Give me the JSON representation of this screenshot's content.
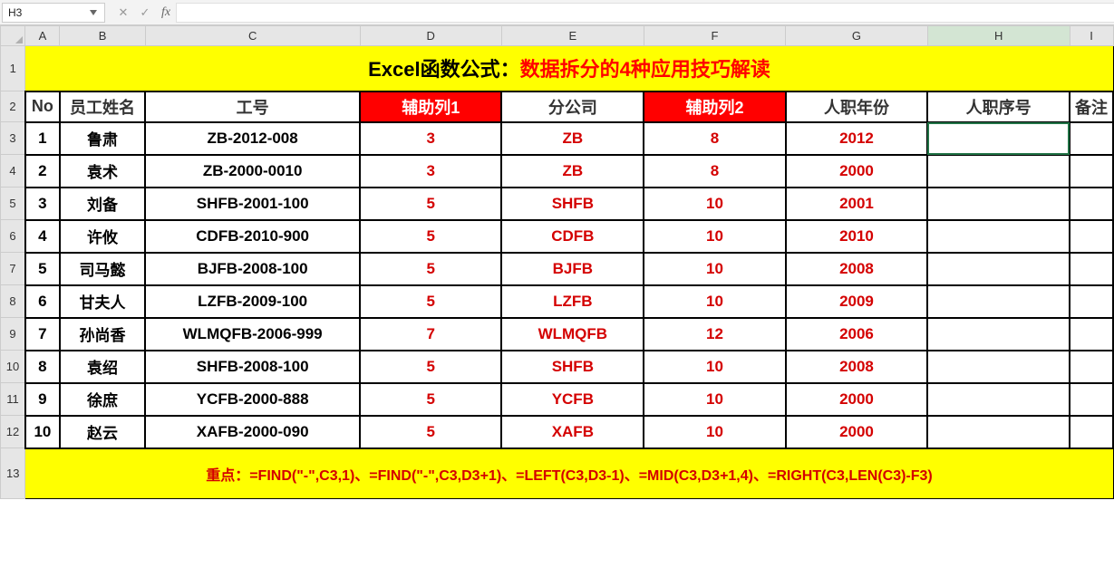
{
  "cellRef": "H3",
  "columns": [
    "A",
    "B",
    "C",
    "D",
    "E",
    "F",
    "G",
    "H",
    "I"
  ],
  "selectedCellCol": "H",
  "colWidths": {
    "A": "w-A",
    "B": "w-B",
    "C": "w-C",
    "D": "w-D",
    "E": "w-E",
    "F": "w-F",
    "G": "w-G",
    "H": "w-H",
    "I": "w-I"
  },
  "rows": [
    1,
    2,
    3,
    4,
    5,
    6,
    7,
    8,
    9,
    10,
    11,
    12,
    13
  ],
  "title_black": "Excel函数公式：",
  "title_red": "数据拆分的4种应用技巧解读",
  "headers": {
    "A": "No",
    "B": "员工姓名",
    "C": "工号",
    "D": "辅助列1",
    "E": "分公司",
    "F": "辅助列2",
    "G": "人职年份",
    "H": "人职序号",
    "I": "备注"
  },
  "redHeaderCols": [
    "D",
    "F"
  ],
  "data": [
    {
      "no": "1",
      "name": "鲁肃",
      "code": "ZB-2012-008",
      "aux1": "3",
      "branch": "ZB",
      "aux2": "8",
      "year": "2012"
    },
    {
      "no": "2",
      "name": "袁术",
      "code": "ZB-2000-0010",
      "aux1": "3",
      "branch": "ZB",
      "aux2": "8",
      "year": "2000"
    },
    {
      "no": "3",
      "name": "刘备",
      "code": "SHFB-2001-100",
      "aux1": "5",
      "branch": "SHFB",
      "aux2": "10",
      "year": "2001"
    },
    {
      "no": "4",
      "name": "许攸",
      "code": "CDFB-2010-900",
      "aux1": "5",
      "branch": "CDFB",
      "aux2": "10",
      "year": "2010"
    },
    {
      "no": "5",
      "name": "司马懿",
      "code": "BJFB-2008-100",
      "aux1": "5",
      "branch": "BJFB",
      "aux2": "10",
      "year": "2008"
    },
    {
      "no": "6",
      "name": "甘夫人",
      "code": "LZFB-2009-100",
      "aux1": "5",
      "branch": "LZFB",
      "aux2": "10",
      "year": "2009"
    },
    {
      "no": "7",
      "name": "孙尚香",
      "code": "WLMQFB-2006-999",
      "aux1": "7",
      "branch": "WLMQFB",
      "aux2": "12",
      "year": "2006"
    },
    {
      "no": "8",
      "name": "袁绍",
      "code": "SHFB-2008-100",
      "aux1": "5",
      "branch": "SHFB",
      "aux2": "10",
      "year": "2008"
    },
    {
      "no": "9",
      "name": "徐庶",
      "code": "YCFB-2000-888",
      "aux1": "5",
      "branch": "YCFB",
      "aux2": "10",
      "year": "2000"
    },
    {
      "no": "10",
      "name": "赵云",
      "code": "XAFB-2000-090",
      "aux1": "5",
      "branch": "XAFB",
      "aux2": "10",
      "year": "2000"
    }
  ],
  "footer": "重点：=FIND(\"-\",C3,1)、=FIND(\"-\",C3,D3+1)、=LEFT(C3,D3-1)、=MID(C3,D3+1,4)、=RIGHT(C3,LEN(C3)-F3)",
  "icons": {
    "cancel": "✕",
    "enter": "✓"
  }
}
